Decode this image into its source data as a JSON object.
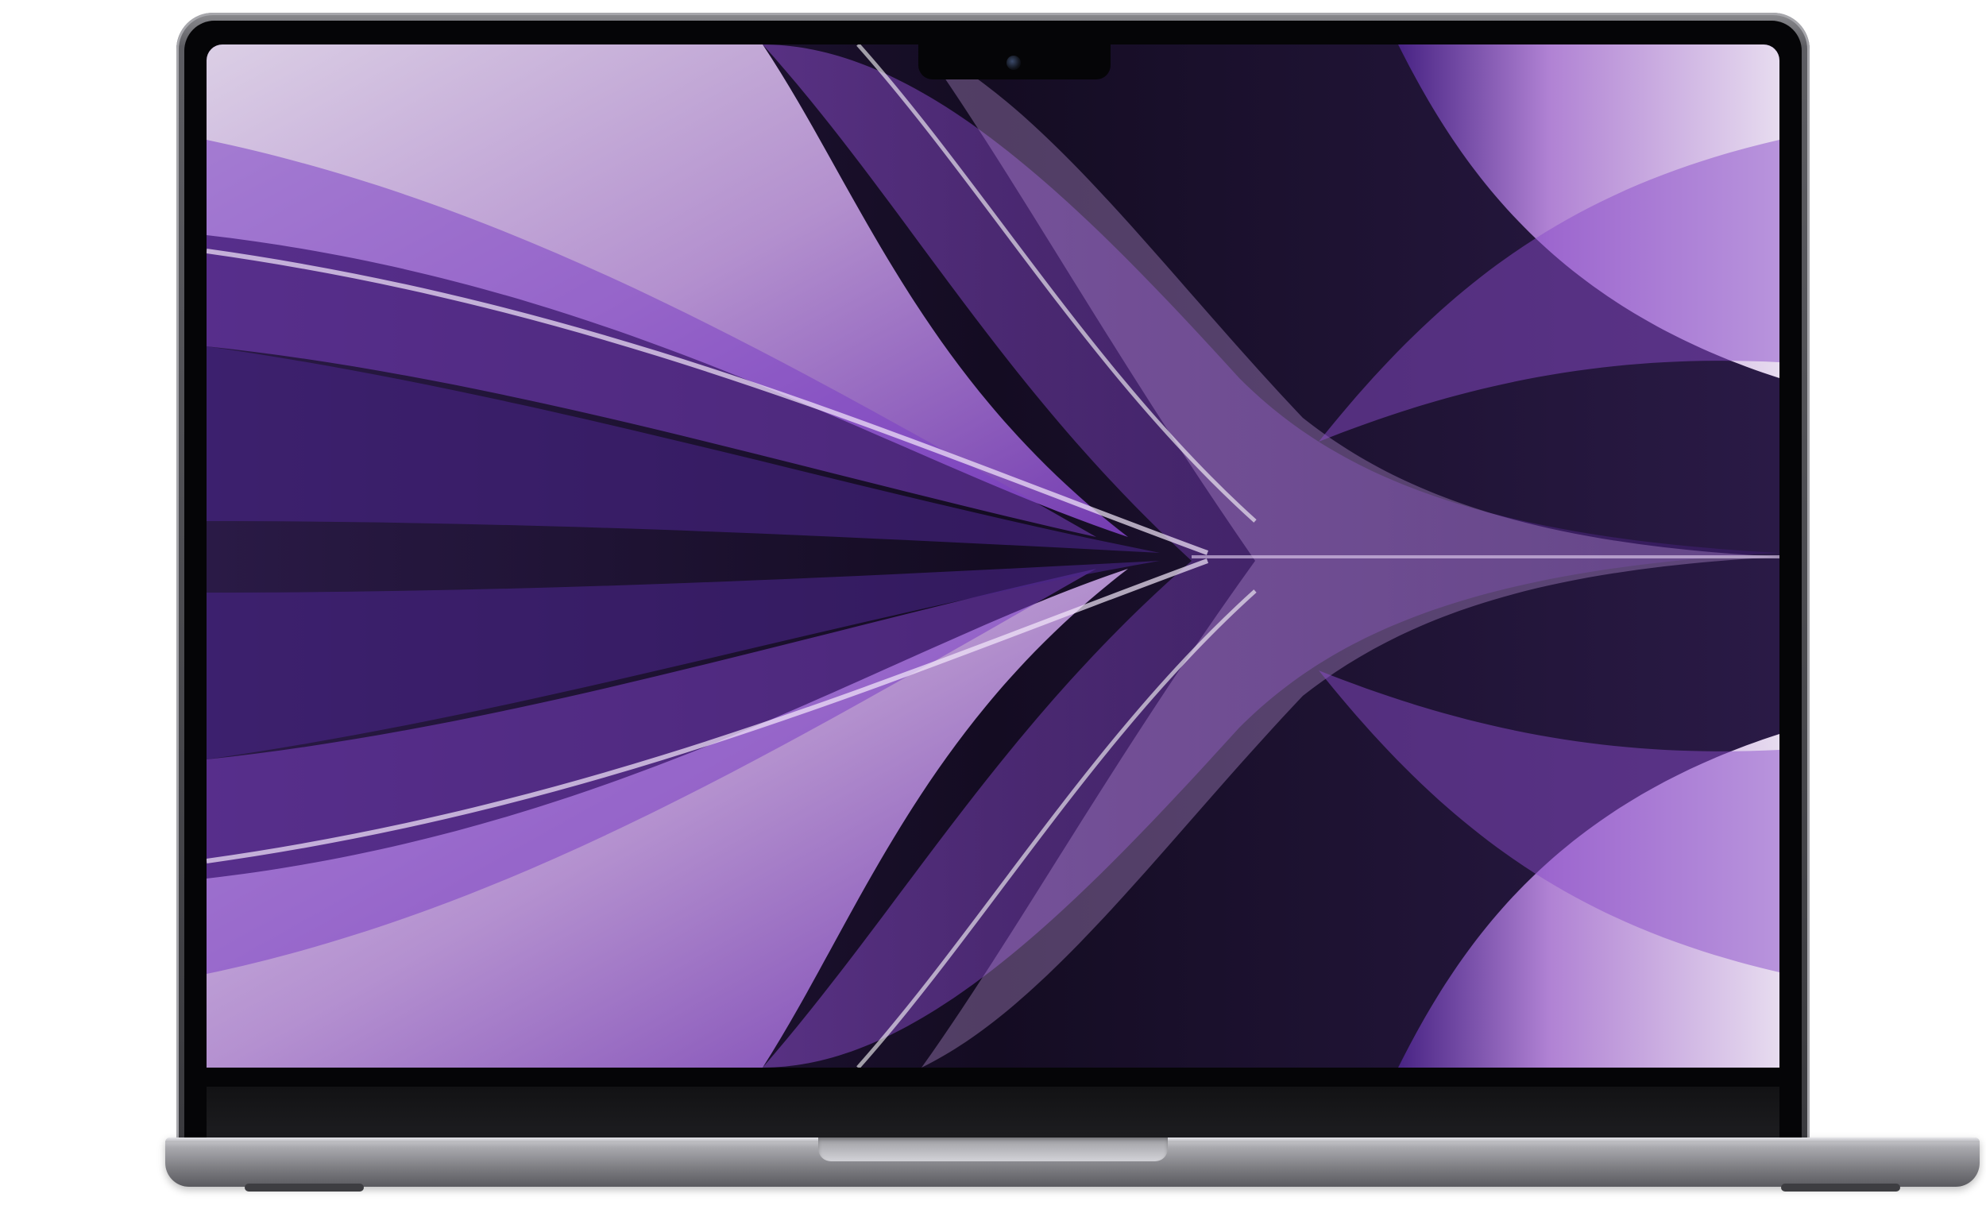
{
  "scene": {
    "subject": "laptop-front-view",
    "wallpaper_colors": {
      "deep": "#1a1028",
      "violet": "#5b2aa8",
      "purple": "#8a4cc9",
      "lilac": "#c8a6e2",
      "highlight": "#efe3f7"
    },
    "body_color": "#7f7f84"
  }
}
